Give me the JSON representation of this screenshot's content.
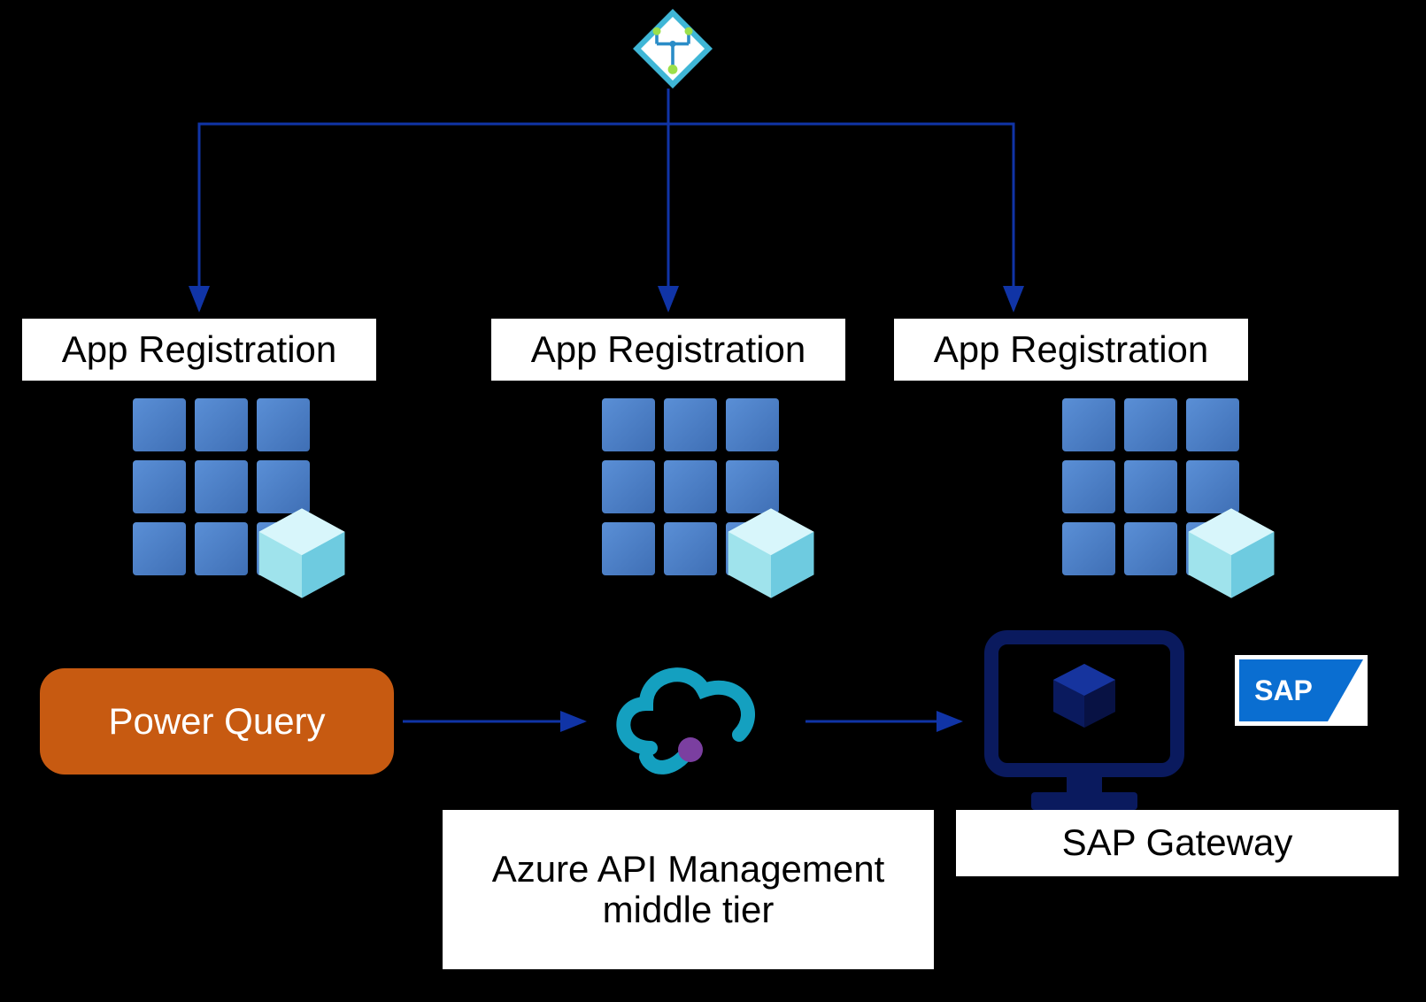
{
  "top": {
    "icon": "azure-active-directory-icon"
  },
  "columns": [
    {
      "app_reg_label": "App Registration"
    },
    {
      "app_reg_label": "App Registration"
    },
    {
      "app_reg_label": "App Registration"
    }
  ],
  "services": {
    "power_query": {
      "label": "Power Query"
    },
    "apim": {
      "label": "Azure API Management middle tier"
    },
    "sap_gateway": {
      "label": "SAP Gateway"
    },
    "sap_logo_text": "SAP"
  },
  "flow": {
    "arrows": [
      "aad-to-col1",
      "aad-to-col2",
      "aad-to-col3",
      "power-query-to-apim",
      "apim-to-sap"
    ]
  },
  "colors": {
    "arrow": "#1034a6",
    "power_query_bg": "#c75a11",
    "apim_cloud": "#14a0c0",
    "sap_monitor": "#0a1a5e",
    "sap_logo_bg": "#0a6ed1"
  }
}
